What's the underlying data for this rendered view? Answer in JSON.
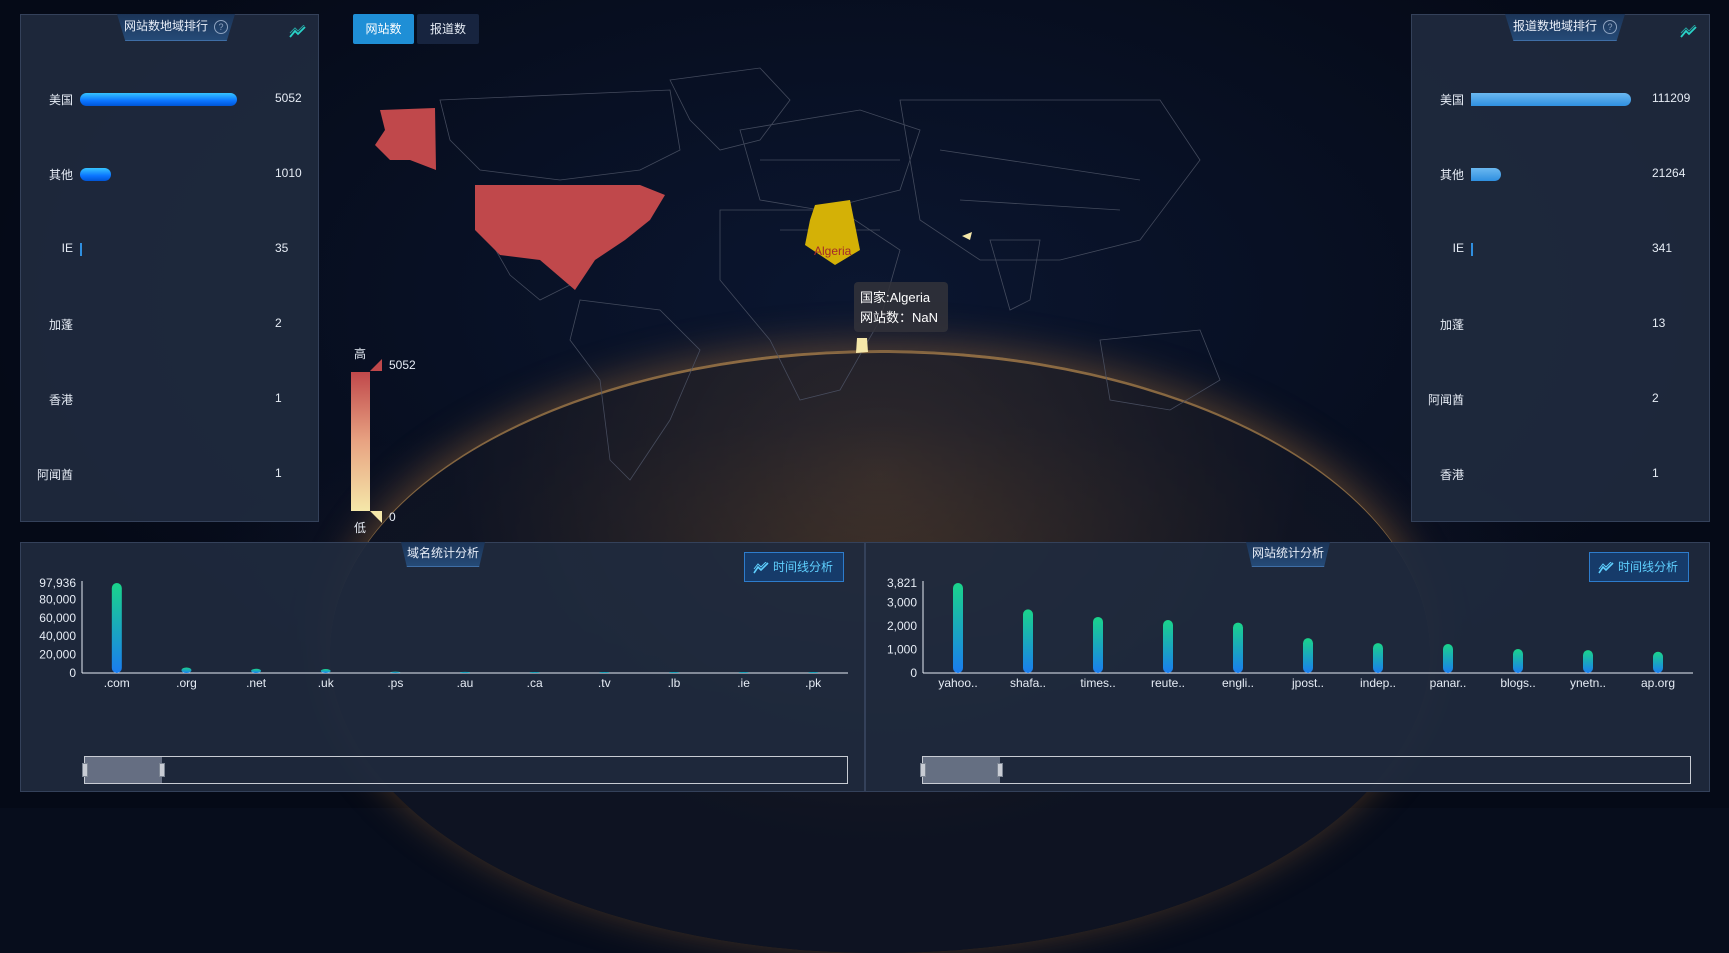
{
  "tabs": [
    {
      "label": "网站数",
      "active": true
    },
    {
      "label": "报道数",
      "active": false
    }
  ],
  "left_panel": {
    "title": "网站数地域排行",
    "rows": [
      {
        "label": "美国",
        "value": "5052",
        "fraction": 1.0
      },
      {
        "label": "其他",
        "value": "1010",
        "fraction": 0.2
      },
      {
        "label": "IE",
        "value": "35",
        "fraction": 0.007
      },
      {
        "label": "加蓬",
        "value": "2",
        "fraction": 0
      },
      {
        "label": "香港",
        "value": "1",
        "fraction": 0
      },
      {
        "label": "阿闻酋",
        "value": "1",
        "fraction": 0
      }
    ]
  },
  "right_panel": {
    "title": "报道数地域排行",
    "rows": [
      {
        "label": "美国",
        "value": "111209",
        "fraction": 1.0
      },
      {
        "label": "其他",
        "value": "21264",
        "fraction": 0.19
      },
      {
        "label": "IE",
        "value": "341",
        "fraction": 0.006
      },
      {
        "label": "加蓬",
        "value": "13",
        "fraction": 0
      },
      {
        "label": "阿闻酋",
        "value": "2",
        "fraction": 0
      },
      {
        "label": "香港",
        "value": "1",
        "fraction": 0
      }
    ]
  },
  "map": {
    "highlight_label": "Algeria",
    "legend": {
      "high_label": "高",
      "low_label": "低",
      "max": "5052",
      "min": "0"
    },
    "tooltip": {
      "line1": "国家:Algeria",
      "line2": "网站数：NaN"
    },
    "colors": {
      "high": "#c0484b",
      "low": "#f5e7a9",
      "selected": "#d4b106"
    }
  },
  "domain_panel": {
    "title": "域名统计分析",
    "timeline_button": "时间线分析",
    "slider_window": [
      0,
      0.1
    ]
  },
  "site_panel": {
    "title": "网站统计分析",
    "timeline_button": "时间线分析",
    "slider_window": [
      0,
      0.1
    ]
  },
  "chart_data": [
    {
      "type": "bar",
      "categories": [
        ".com",
        ".org",
        ".net",
        ".uk",
        ".ps",
        ".au",
        ".ca",
        ".tv",
        ".lb",
        ".ie",
        ".pk"
      ],
      "values": [
        97936,
        6000,
        4600,
        4300,
        1500,
        1200,
        600,
        450,
        350,
        300,
        250
      ],
      "ylim": [
        0,
        97936
      ],
      "yticks": [
        "0",
        "20,000",
        "40,000",
        "60,000",
        "80,000",
        "97,936"
      ],
      "ytick_values": [
        0,
        20000,
        40000,
        60000,
        80000,
        97936
      ],
      "title": "",
      "xlabel": "",
      "ylabel": ""
    },
    {
      "type": "bar",
      "categories": [
        "yahoo..",
        "shafa..",
        "times..",
        "reute..",
        "engli..",
        "jpost..",
        "indep..",
        "panar..",
        "blogs..",
        "ynetn..",
        "ap.org"
      ],
      "values": [
        3821,
        2700,
        2380,
        2250,
        2140,
        1480,
        1270,
        1230,
        1020,
        970,
        900
      ],
      "ylim": [
        0,
        3821
      ],
      "yticks": [
        "0",
        "1,000",
        "2,000",
        "3,000",
        "3,821"
      ],
      "ytick_values": [
        0,
        1000,
        2000,
        3000,
        3821
      ],
      "title": "",
      "xlabel": "",
      "ylabel": ""
    }
  ]
}
